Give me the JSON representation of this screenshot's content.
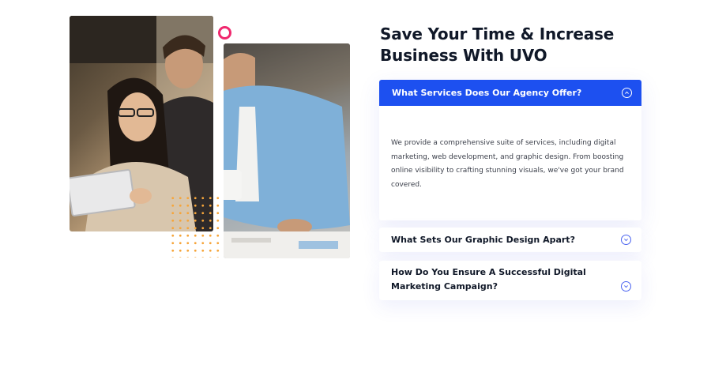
{
  "images": {
    "left": "woman-with-tablet-and-man-photo",
    "right": "man-leaning-on-desk-photo"
  },
  "decor": {
    "ring_color": "#f0286e",
    "dots_color": "#f6a53a"
  },
  "section": {
    "title_line1": "Save Your Time & Increase",
    "title_line2": "Business With UVO"
  },
  "faq": [
    {
      "question": "What Services Does Our Agency Offer?",
      "answer": "We provide a comprehensive suite of services, including digital marketing, web development, and graphic design. From boosting online visibility to crafting stunning visuals, we've got your brand covered.",
      "expanded": true,
      "icon": "chevron-up-icon"
    },
    {
      "question": "What Sets Our Graphic Design Apart?",
      "expanded": false,
      "icon": "chevron-down-icon"
    },
    {
      "question": "How Do You Ensure A Successful Digital Marketing Campaign?",
      "expanded": false,
      "icon": "chevron-down-icon"
    }
  ],
  "colors": {
    "accent": "#1d50f0",
    "heading": "#101828",
    "body_text": "#3b3f4a"
  }
}
